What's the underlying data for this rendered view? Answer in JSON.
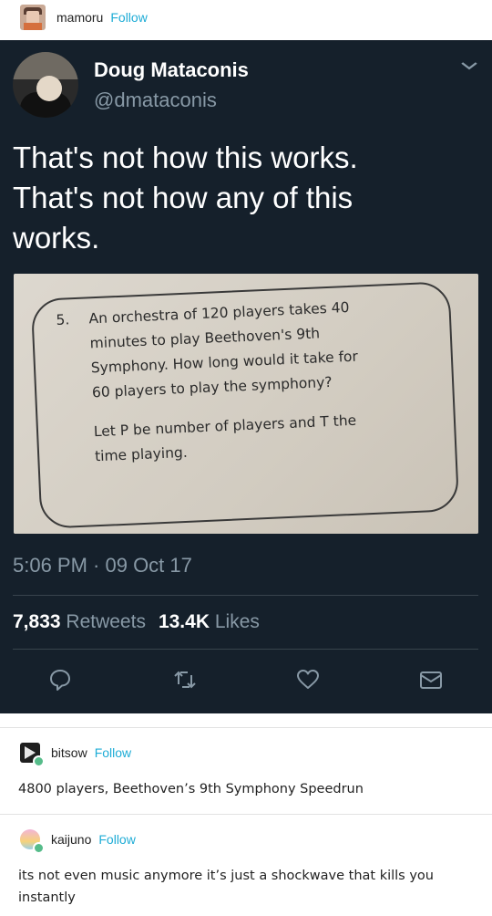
{
  "post": {
    "username": "mamoru",
    "follow_label": "Follow"
  },
  "tweet": {
    "name": "Doug Mataconis",
    "handle": "@dmataconis",
    "text_line1": "That's not how this works.",
    "text_line2": "That's not how any of this",
    "text_line3": "works.",
    "photo": {
      "question_number": "5.",
      "lines": [
        "An orchestra of 120 players takes 40",
        "minutes to play Beethoven's 9th",
        "Symphony. How long would it take for",
        "60 players to play the symphony?",
        "Let P be number of players and T the",
        "time playing."
      ]
    },
    "time": "5:06 PM · 09 Oct 17",
    "retweets_count": "7,833",
    "retweets_label": "Retweets",
    "likes_count": "13.4K",
    "likes_label": "Likes"
  },
  "reblogs": [
    {
      "username": "bitsow",
      "follow_label": "Follow",
      "text": "4800 players, Beethoven’s 9th Symphony Speedrun"
    },
    {
      "username": "kaijuno",
      "follow_label": "Follow",
      "text_line1": "its not even music anymore it’s just a shockwave that kills you",
      "text_line2": "instantly"
    }
  ],
  "colors": {
    "tweet_bg": "#15202b",
    "link_blue": "#1eacd6",
    "muted": "#8899a6",
    "reblog_badge": "#56bc8a"
  }
}
